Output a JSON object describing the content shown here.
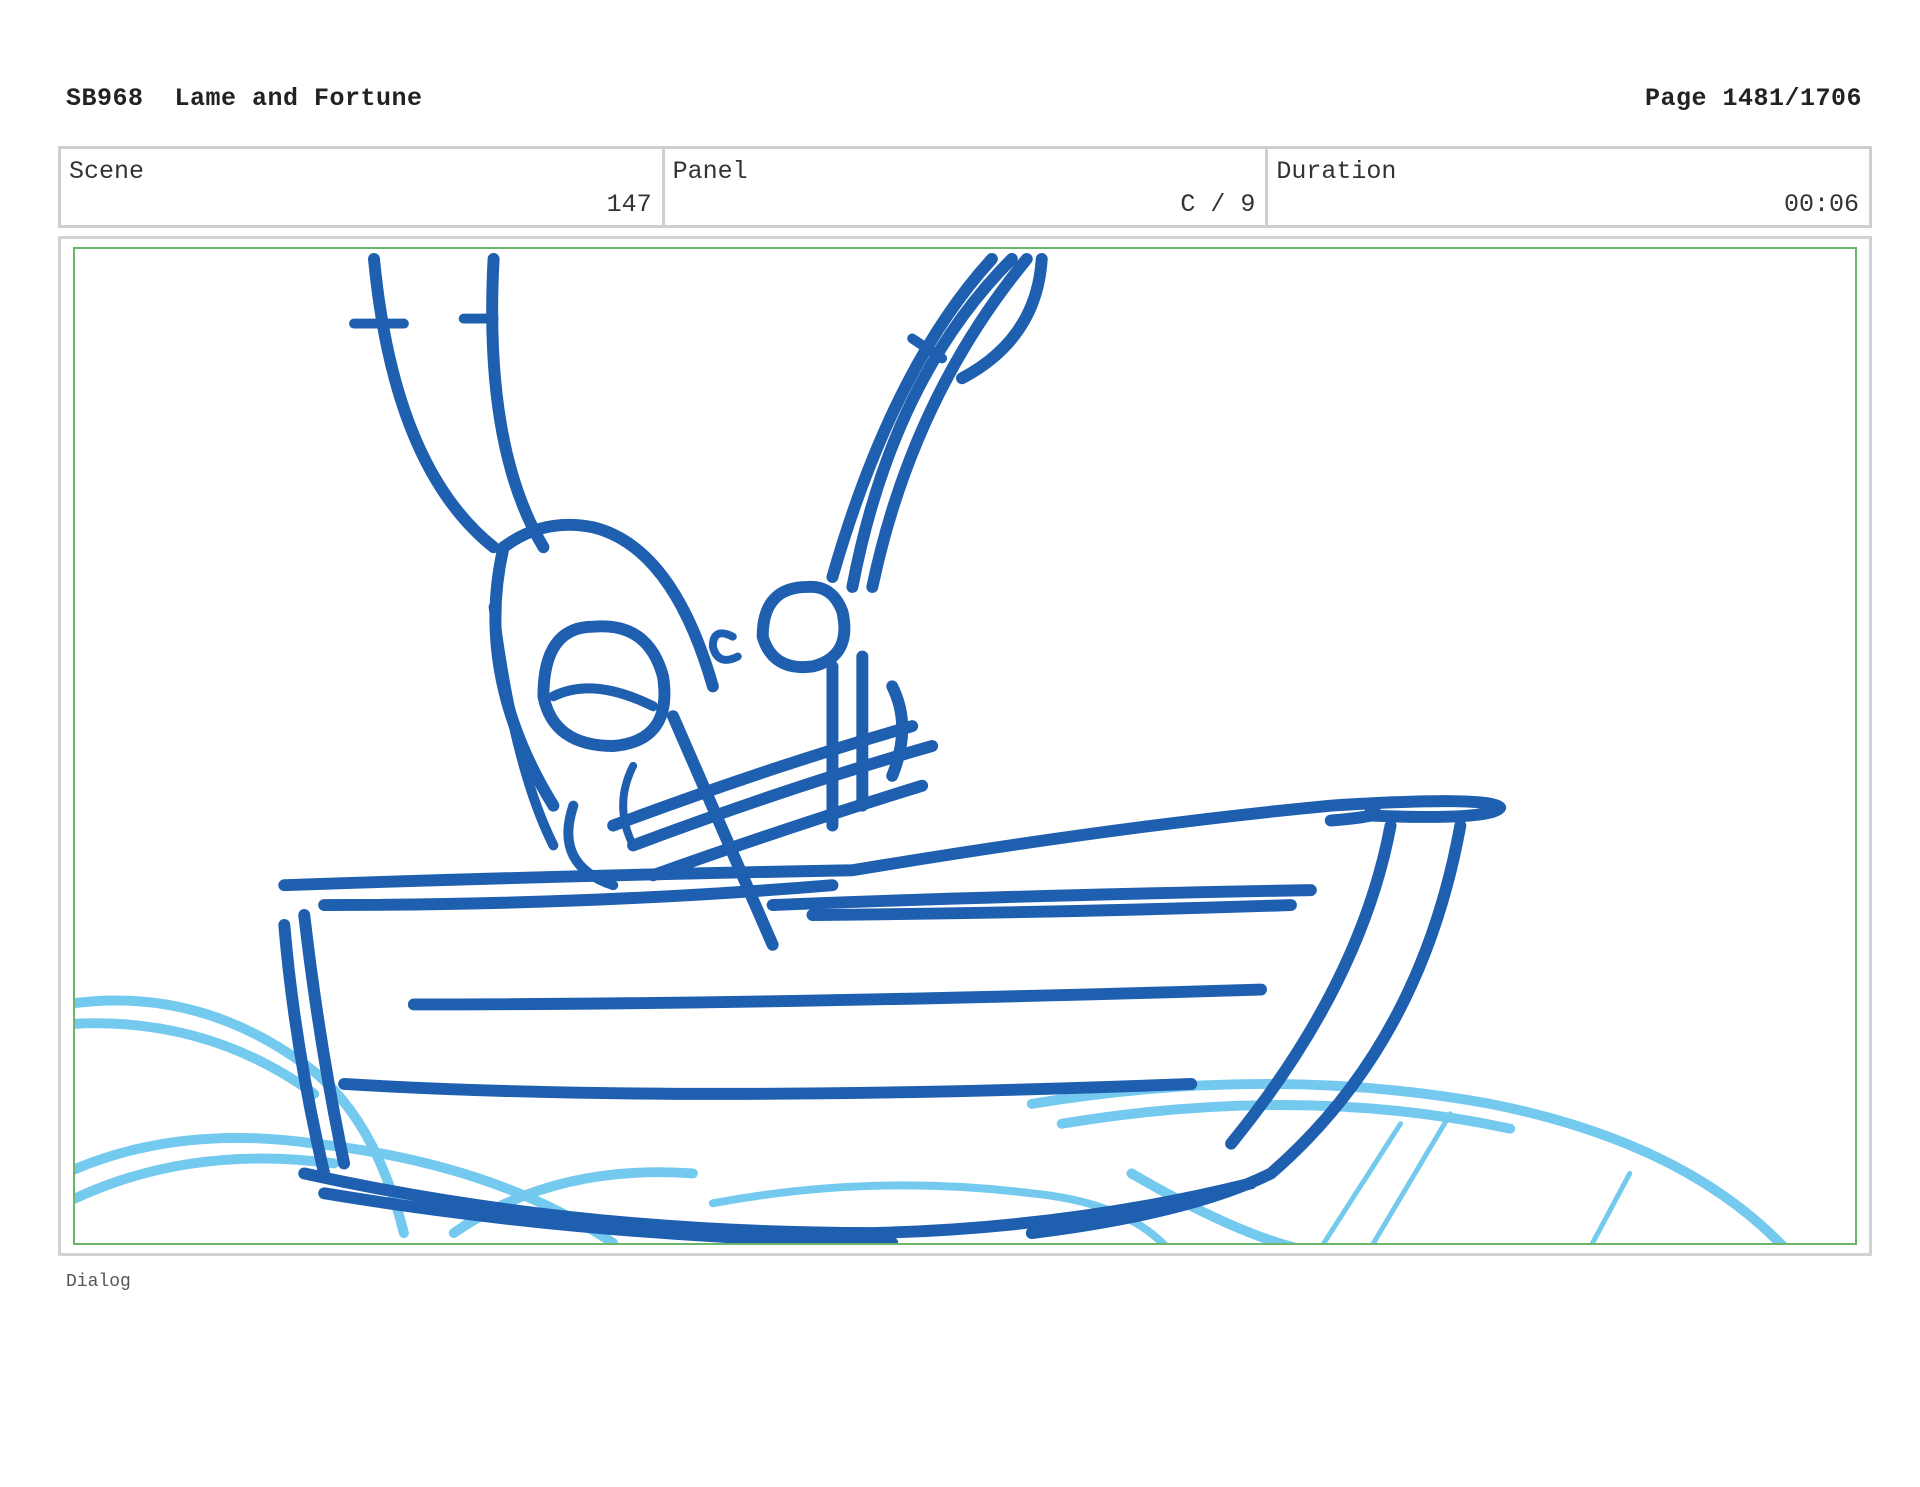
{
  "header": {
    "left": "SB968  Lame and Fortune",
    "right": "Page 1481/1706"
  },
  "info": {
    "scene": {
      "label": "Scene",
      "value": "147"
    },
    "panel": {
      "label": "Panel",
      "value": "C / 9"
    },
    "duration": {
      "label": "Duration",
      "value": "00:06"
    }
  },
  "panel_art": {
    "subject": "boat-sketch",
    "stroke_color_dark": "#1f5fb0",
    "stroke_color_light": "#5cc0ec"
  },
  "dialog": {
    "label": "Dialog"
  }
}
